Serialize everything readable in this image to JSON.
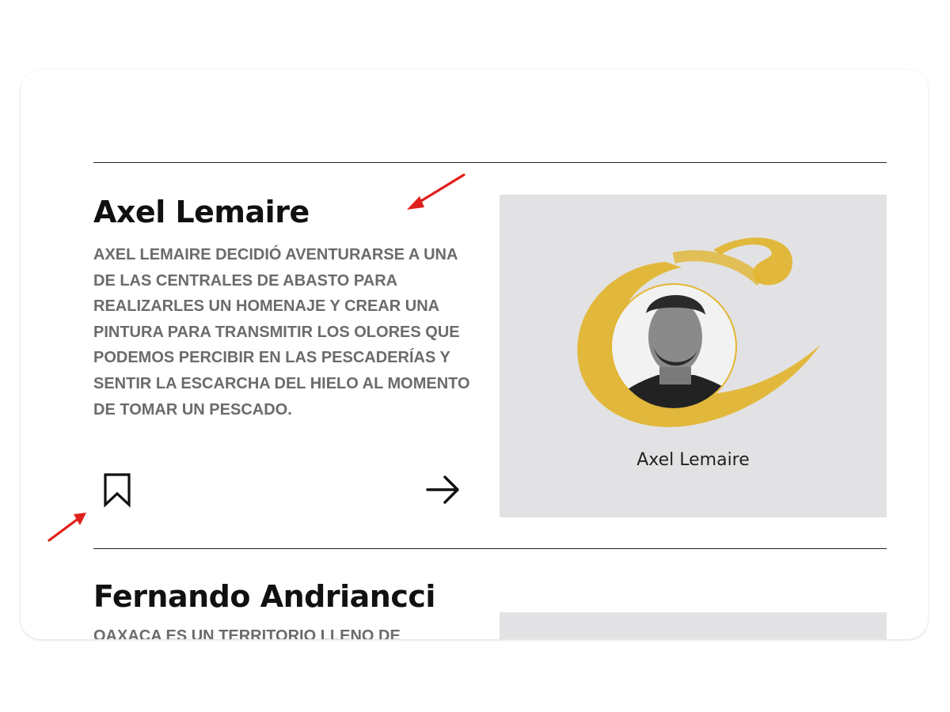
{
  "articles": [
    {
      "title": "Axel Lemaire",
      "description": "AXEL LEMAIRE DECIDIÓ AVENTURARSE A UNA DE LAS CENTRALES DE ABASTO PARA REALIZARLES UN HOMENAJE Y CREAR UNA PINTURA PARA TRANSMITIR LOS OLORES QUE PODEMOS PERCIBIR EN LAS PESCADERÍAS Y SENTIR LA ESCARCHA DEL HIELO AL MOMENTO DE TOMAR UN PESCADO.",
      "image_caption": "Axel Lemaire",
      "bookmark_icon": "bookmark-icon",
      "arrow_icon": "arrow-right-icon"
    },
    {
      "title": "Fernando Andriancci",
      "description": "OAXACA ES UN TERRITORIO LLENO DE"
    }
  ],
  "colors": {
    "accent_yellow": "#e2b533",
    "annotation_red": "#e0201b",
    "image_panel_bg": "#e2e2e4",
    "description_gray": "#6b6b6b"
  }
}
